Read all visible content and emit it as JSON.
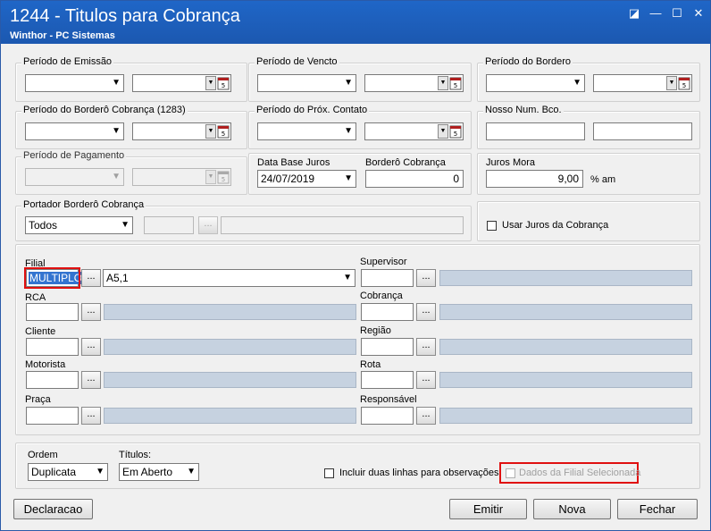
{
  "window": {
    "title": "1244 - Titulos para Cobrança",
    "subtitle": "Winthor - PC Sistemas",
    "controls": {
      "restore": "◪",
      "minimize": "—",
      "maximize": "☐",
      "close": "✕"
    }
  },
  "periodos": {
    "emissao": "Período de Emissão",
    "vencto": "Período de Vencto",
    "bordero": "Período do Bordero",
    "bordero_cobranca": "Período do Borderô Cobrança (1283)",
    "prox_contato": "Período do Próx. Contato",
    "nosso_num": "Nosso Num. Bco.",
    "pagamento": "Período de Pagamento"
  },
  "juros": {
    "data_base_label": "Data Base Juros",
    "data_base_value": "24/07/2019",
    "bordero_cobranca_label": "Borderô Cobrança",
    "bordero_cobranca_value": "0",
    "juros_mora_label": "Juros Mora",
    "juros_mora_value": "9,00",
    "juros_mora_unit": "% am"
  },
  "portador": {
    "label": "Portador Borderô Cobrança",
    "selected": "Todos"
  },
  "usar_juros_label": "Usar Juros da Cobrança",
  "filtros": {
    "filial": {
      "label": "Filial",
      "value": "MULTIPLOS",
      "desc": "A5,1"
    },
    "rca": {
      "label": "RCA"
    },
    "cliente": {
      "label": "Cliente"
    },
    "motorista": {
      "label": "Motorista"
    },
    "praca": {
      "label": "Praça"
    },
    "supervisor": {
      "label": "Supervisor"
    },
    "cobranca": {
      "label": "Cobrança"
    },
    "regiao": {
      "label": "Região"
    },
    "rota": {
      "label": "Rota"
    },
    "responsavel": {
      "label": "Responsável"
    }
  },
  "ellipsis": "...",
  "ordem": {
    "label": "Ordem",
    "selected": "Duplicata"
  },
  "titulos": {
    "label": "Títulos:",
    "selected": "Em Aberto"
  },
  "incluir_label": "Incluir duas linhas para observações",
  "dados_filial_label": "Dados da Filial Selecionada",
  "buttons": {
    "declaracao": "Declaracao",
    "emitir": "Emitir",
    "nova": "Nova",
    "fechar": "Fechar"
  },
  "colors": {
    "titlebar": "#1f66c7",
    "highlight": "#e01010",
    "readonly": "#c6d2e0"
  }
}
